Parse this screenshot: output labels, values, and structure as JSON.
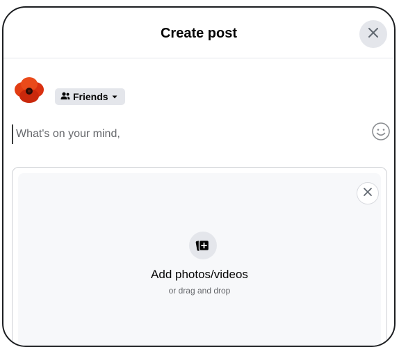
{
  "dialog": {
    "title": "Create post",
    "close_icon": "close-icon"
  },
  "author": {
    "avatar": "poppy-flower-avatar"
  },
  "audience": {
    "label": "Friends",
    "icon": "friends-icon",
    "chevron": "caret-down-icon"
  },
  "composer": {
    "placeholder": "What's on your mind,",
    "value": "",
    "emoji_icon": "smiley-icon"
  },
  "media": {
    "add_label": "Add photos/videos",
    "drag_label": "or drag and drop",
    "icon": "add-photo-icon",
    "close_icon": "close-icon"
  },
  "colors": {
    "button_gray": "#e4e6eb",
    "upload_bg": "#f7f8fa",
    "text_primary": "#050505",
    "text_secondary": "#65676b"
  }
}
